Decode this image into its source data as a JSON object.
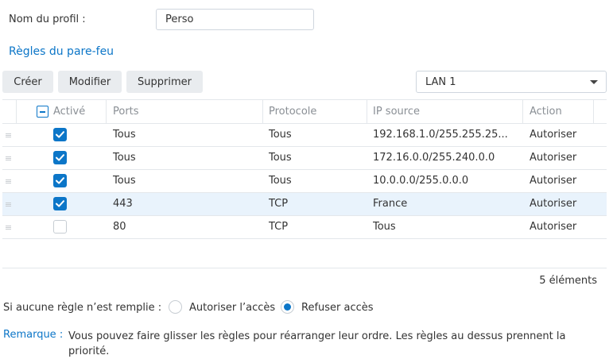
{
  "profile": {
    "label": "Nom du profil :",
    "value": "Perso"
  },
  "section_title": "Règles du pare-feu",
  "toolbar": {
    "create": "Créer",
    "edit": "Modifier",
    "delete": "Supprimer"
  },
  "interface_select": {
    "value": "LAN 1"
  },
  "table": {
    "headers": {
      "enabled": "Activé",
      "ports": "Ports",
      "protocol": "Protocole",
      "source_ip": "IP source",
      "action": "Action"
    },
    "rows": [
      {
        "enabled": true,
        "ports": "Tous",
        "protocol": "Tous",
        "source_ip": "192.168.1.0/255.255.25...",
        "action": "Autoriser",
        "selected": false
      },
      {
        "enabled": true,
        "ports": "Tous",
        "protocol": "Tous",
        "source_ip": "172.16.0.0/255.240.0.0",
        "action": "Autoriser",
        "selected": false
      },
      {
        "enabled": true,
        "ports": "Tous",
        "protocol": "Tous",
        "source_ip": "10.0.0.0/255.0.0.0",
        "action": "Autoriser",
        "selected": false
      },
      {
        "enabled": true,
        "ports": "443",
        "protocol": "TCP",
        "source_ip": "France",
        "action": "Autoriser",
        "selected": true
      },
      {
        "enabled": false,
        "ports": "80",
        "protocol": "TCP",
        "source_ip": "Tous",
        "action": "Autoriser",
        "selected": false
      }
    ],
    "count": "5 éléments"
  },
  "no_rule": {
    "label": "Si aucune règle n’est remplie :",
    "options": [
      {
        "label": "Autoriser l’accès",
        "selected": false
      },
      {
        "label": "Refuser accès",
        "selected": true
      }
    ]
  },
  "remark": {
    "label": "Remarque :",
    "text": "Vous pouvez faire glisser les règles pour réarranger leur ordre. Les règles au dessus prennent la priorité."
  },
  "colors": {
    "accent": "#0c76c8",
    "selected_row": "#e9f3fc",
    "button_bg": "#e9ecef",
    "border": "#e3e7eb"
  },
  "icons": {
    "enabled_header": "indeterminate-checkbox-icon",
    "row_handle": "drag-handle-icon",
    "select": "chevron-down-icon"
  }
}
